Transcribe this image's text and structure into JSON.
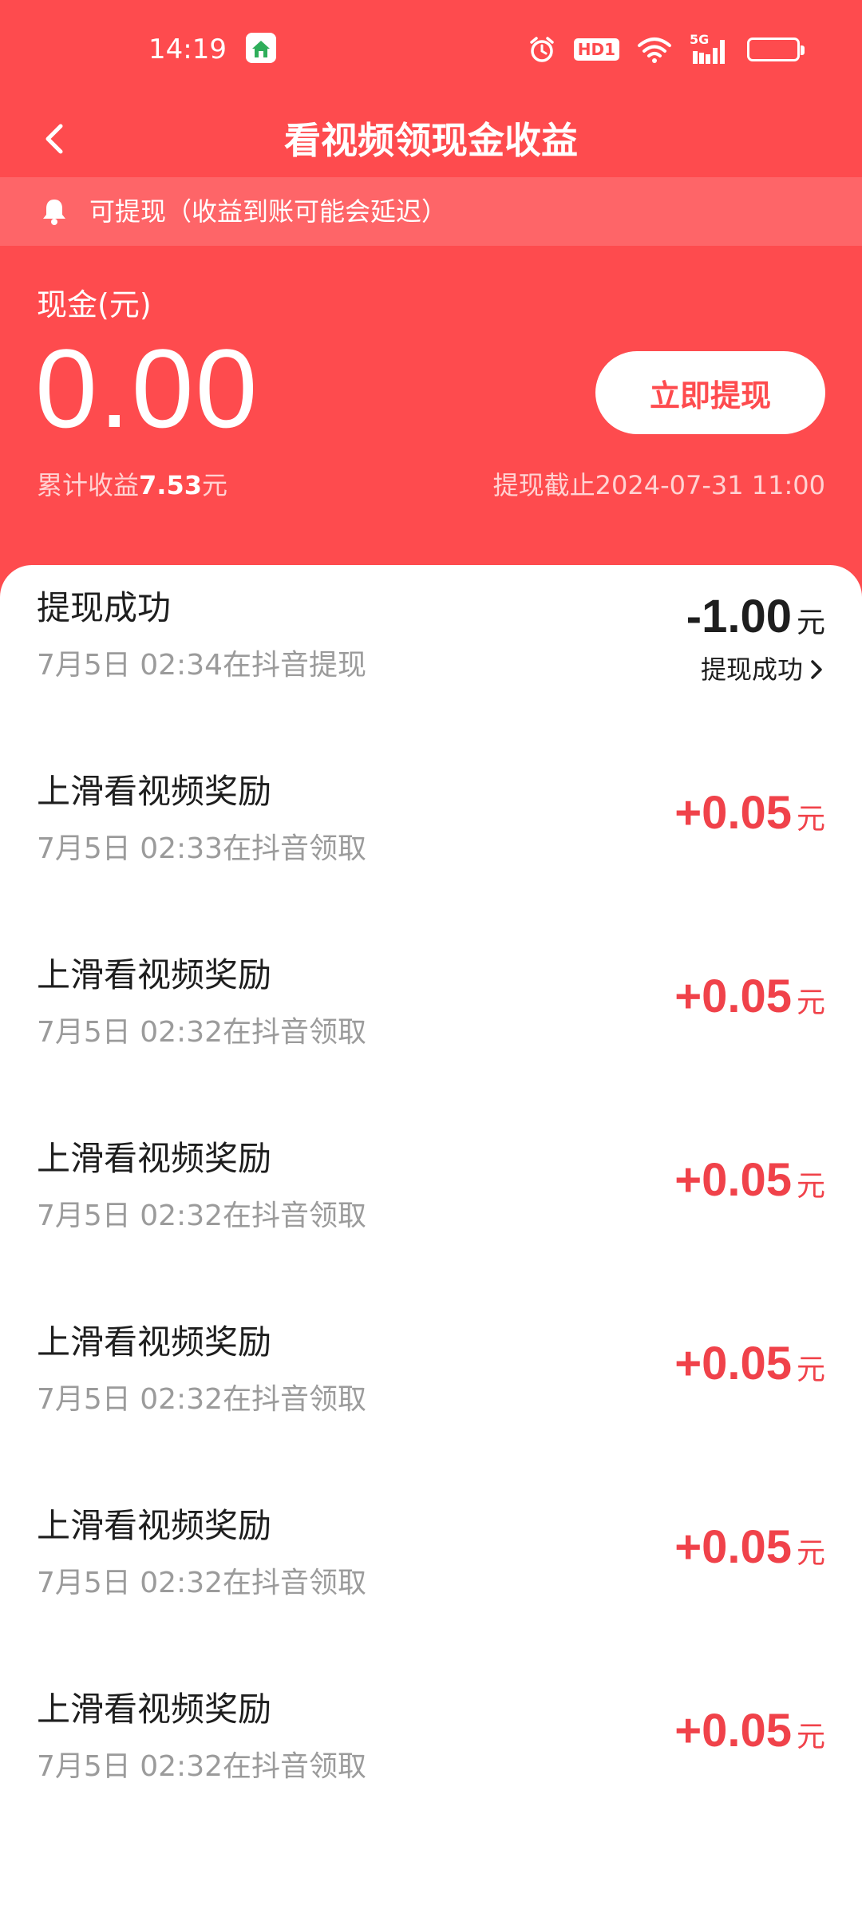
{
  "status_bar": {
    "time": "14:19",
    "icons": [
      "app-icon",
      "alarm-icon",
      "hd-icon",
      "wifi-icon",
      "5g-signal-icon",
      "battery-icon"
    ],
    "hd_label": "HD1",
    "network_label": "5G"
  },
  "nav": {
    "title": "看视频领现金收益",
    "back_icon": "chevron-left-icon"
  },
  "notice": {
    "icon": "bell-icon",
    "text": "可提现（收益到账可能会延迟）"
  },
  "cash": {
    "label": "现金(元)",
    "amount": "0.00",
    "withdraw_label": "立即提现",
    "total_prefix": "累计收益",
    "total_value": "7.53",
    "total_unit": "元",
    "deadline": "提现截止2024-07-31 11:00"
  },
  "colors": {
    "brand": "#fe4b4e",
    "positive_amount": "#f0424a",
    "text_primary": "#1e1e1e",
    "text_secondary": "#9b9b9b"
  },
  "records": [
    {
      "title": "提现成功",
      "subtitle": "7月5日 02:34在抖音提现",
      "amount": "-1.00",
      "unit": "元",
      "status": "提现成功"
    },
    {
      "title": "上滑看视频奖励",
      "subtitle": "7月5日 02:33在抖音领取",
      "amount": "+0.05",
      "unit": "元"
    },
    {
      "title": "上滑看视频奖励",
      "subtitle": "7月5日 02:32在抖音领取",
      "amount": "+0.05",
      "unit": "元"
    },
    {
      "title": "上滑看视频奖励",
      "subtitle": "7月5日 02:32在抖音领取",
      "amount": "+0.05",
      "unit": "元"
    },
    {
      "title": "上滑看视频奖励",
      "subtitle": "7月5日 02:32在抖音领取",
      "amount": "+0.05",
      "unit": "元"
    },
    {
      "title": "上滑看视频奖励",
      "subtitle": "7月5日 02:32在抖音领取",
      "amount": "+0.05",
      "unit": "元"
    },
    {
      "title": "上滑看视频奖励",
      "subtitle": "7月5日 02:32在抖音领取",
      "amount": "+0.05",
      "unit": "元"
    }
  ]
}
